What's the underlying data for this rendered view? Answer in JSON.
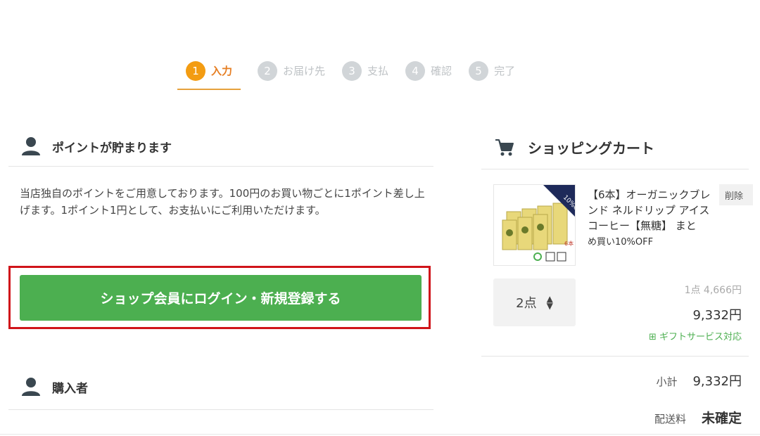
{
  "steps": [
    {
      "num": "1",
      "label": "入力"
    },
    {
      "num": "2",
      "label": "お届け先"
    },
    {
      "num": "3",
      "label": "支払"
    },
    {
      "num": "4",
      "label": "確認"
    },
    {
      "num": "5",
      "label": "完了"
    }
  ],
  "points_section": {
    "title": "ポイントが貯まります",
    "description": "当店独自のポイントをご用意しております。100円のお買い物ごとに1ポイント差し上げます。1ポイント1円として、お支払いにご利用いただけます。",
    "login_button": "ショップ会員にログイン・新規登録する"
  },
  "buyer_section": {
    "title": "購入者"
  },
  "cart": {
    "title": "ショッピングカート",
    "product_name": "【6本】オーガニックブレンド ネルドリップ アイスコーヒー【無糖】 まとめ買い10%OFF",
    "product_name_main": "【6本】オーガニックブレンド ネルドリップ アイスコーヒー【無糖】 まと",
    "product_name_tail": "め買い10%OFF",
    "badge": "10%OFF",
    "delete_label": "削除",
    "quantity": "2点",
    "unit_price": "1点 4,666円",
    "total_price": "9,332円",
    "gift_label": "ギフトサービス対応",
    "subtotal_label": "小計",
    "subtotal_value": "9,332円",
    "shipping_label": "配送料",
    "shipping_value": "未確定"
  }
}
